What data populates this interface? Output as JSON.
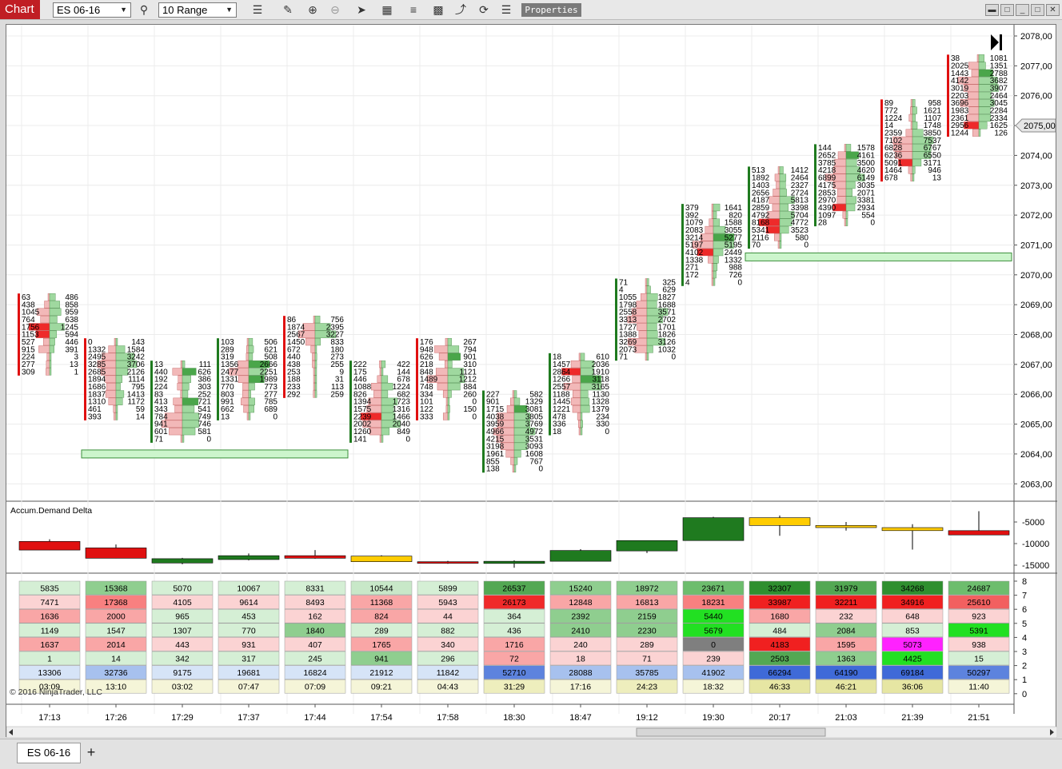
{
  "toolbar": {
    "title": "Chart",
    "instrument": "ES 06-16",
    "period": "10 Range",
    "properties_label": "Properties",
    "icons": [
      "search-icon",
      "bar-type-icon",
      "pencil-icon",
      "zoom-in-icon",
      "zoom-out-icon",
      "pointer-icon",
      "data-box-icon",
      "strategy-icon",
      "indicator-icon",
      "drawing-tools-icon",
      "reload-icon",
      "list-icon"
    ]
  },
  "window_buttons": [
    "minimize",
    "restore",
    "maximize",
    "close"
  ],
  "indicator_label": "Accum.Demand Delta",
  "copyright": "© 2016 NinjaTrader, LLC",
  "price_axis": [
    "2078,00",
    "2077,00",
    "2076,00",
    "2075,00",
    "2074,00",
    "2073,00",
    "2072,00",
    "2071,00",
    "2070,00",
    "2069,00",
    "2068,00",
    "2067,00",
    "2066,00",
    "2065,00",
    "2064,00",
    "2063,00"
  ],
  "current_price": "2075,00",
  "delta_axis": [
    "-5000",
    "-10000",
    "-15000"
  ],
  "table_axis": [
    "8",
    "7",
    "6",
    "5",
    "4",
    "3",
    "2",
    "1",
    "0"
  ],
  "time_labels": [
    "17:13",
    "17:26",
    "17:29",
    "17:37",
    "17:44",
    "17:54",
    "17:58",
    "18:30",
    "18:47",
    "19:12",
    "19:30",
    "20:17",
    "21:03",
    "21:39",
    "21:51"
  ],
  "colors": {
    "up": "#1f7a1f",
    "down": "#e01010",
    "neutral": "#ffcc00",
    "bid_bar": "#f2b8b8",
    "ask_bar": "#9fd89f"
  },
  "bars": [
    {
      "top": 2069.25,
      "side": "down",
      "rows": [
        [
          "63",
          "486"
        ],
        [
          "438",
          "858"
        ],
        [
          "1045",
          "959"
        ],
        [
          "764",
          "638"
        ],
        [
          "1756",
          "1245"
        ],
        [
          "1153",
          "594"
        ],
        [
          "527",
          "446"
        ],
        [
          "915",
          "391"
        ],
        [
          "224",
          "3"
        ],
        [
          "277",
          "13"
        ],
        [
          "309",
          "1"
        ]
      ]
    },
    {
      "top": 2067.75,
      "side": "down",
      "rows": [
        [
          "0",
          "143"
        ],
        [
          "1332",
          "1584"
        ],
        [
          "2495",
          "3242"
        ],
        [
          "3285",
          "3706"
        ],
        [
          "2685",
          "2126"
        ],
        [
          "1894",
          "1114"
        ],
        [
          "1686",
          "795"
        ],
        [
          "1837",
          "1413"
        ],
        [
          "1310",
          "1172"
        ],
        [
          "461",
          "59"
        ],
        [
          "393",
          "14"
        ]
      ]
    },
    {
      "top": 2067.0,
      "side": "up",
      "rows": [
        [
          "13",
          "111"
        ],
        [
          "440",
          "626"
        ],
        [
          "192",
          "386"
        ],
        [
          "224",
          "303"
        ],
        [
          "83",
          "252"
        ],
        [
          "413",
          "721"
        ],
        [
          "343",
          "541"
        ],
        [
          "784",
          "749"
        ],
        [
          "941",
          "746"
        ],
        [
          "601",
          "581"
        ],
        [
          "71",
          "0"
        ]
      ]
    },
    {
      "top": 2067.75,
      "side": "up",
      "rows": [
        [
          "103",
          "506"
        ],
        [
          "289",
          "621"
        ],
        [
          "319",
          "508"
        ],
        [
          "1356",
          "2666"
        ],
        [
          "2477",
          "2251"
        ],
        [
          "1331",
          "1989"
        ],
        [
          "770",
          "773"
        ],
        [
          "803",
          "277"
        ],
        [
          "991",
          "785"
        ],
        [
          "662",
          "689"
        ],
        [
          "13",
          "0"
        ]
      ]
    },
    {
      "top": 2068.5,
      "side": "down",
      "rows": [
        [
          "86",
          "756"
        ],
        [
          "1874",
          "2395"
        ],
        [
          "2567",
          "3227"
        ],
        [
          "1450",
          "833"
        ],
        [
          "672",
          "180"
        ],
        [
          "440",
          "273"
        ],
        [
          "438",
          "255"
        ],
        [
          "253",
          "9"
        ],
        [
          "188",
          "31"
        ],
        [
          "233",
          "113"
        ],
        [
          "292",
          "259"
        ]
      ]
    },
    {
      "top": 2067.0,
      "side": "up",
      "rows": [
        [
          "222",
          "422"
        ],
        [
          "175",
          "144"
        ],
        [
          "446",
          "678"
        ],
        [
          "1088",
          "1224"
        ],
        [
          "826",
          "682"
        ],
        [
          "1394",
          "1723"
        ],
        [
          "1575",
          "1316"
        ],
        [
          "2239",
          "1466"
        ],
        [
          "2002",
          "2040"
        ],
        [
          "1260",
          "849"
        ],
        [
          "141",
          "0"
        ]
      ]
    },
    {
      "top": 2067.75,
      "side": "down",
      "rows": [
        [
          "176",
          "267"
        ],
        [
          "948",
          "794"
        ],
        [
          "626",
          "901"
        ],
        [
          "218",
          "310"
        ],
        [
          "848",
          "1121"
        ],
        [
          "1489",
          "1212"
        ],
        [
          "748",
          "884"
        ],
        [
          "334",
          "260"
        ],
        [
          "101",
          "0"
        ],
        [
          "122",
          "150"
        ],
        [
          "333",
          "0"
        ]
      ]
    },
    {
      "top": 2066.0,
      "side": "up",
      "rows": [
        [
          "227",
          "582"
        ],
        [
          "901",
          "1329"
        ],
        [
          "1715",
          "3081"
        ],
        [
          "4038",
          "3805"
        ],
        [
          "3959",
          "3769"
        ],
        [
          "4966",
          "4972"
        ],
        [
          "4215",
          "3531"
        ],
        [
          "3198",
          "3093"
        ],
        [
          "1961",
          "1608"
        ],
        [
          "855",
          "767"
        ],
        [
          "138",
          "0"
        ]
      ]
    },
    {
      "top": 2067.25,
      "side": "up",
      "rows": [
        [
          "18",
          "610"
        ],
        [
          "1457",
          "2036"
        ],
        [
          "2864",
          "1910"
        ],
        [
          "1266",
          "3118"
        ],
        [
          "2557",
          "3165"
        ],
        [
          "1188",
          "1130"
        ],
        [
          "1445",
          "1328"
        ],
        [
          "1221",
          "1379"
        ],
        [
          "478",
          "234"
        ],
        [
          "336",
          "330"
        ],
        [
          "18",
          "0"
        ]
      ]
    },
    {
      "top": 2069.75,
      "side": "up",
      "rows": [
        [
          "71",
          "325"
        ],
        [
          "4",
          "629"
        ],
        [
          "1055",
          "1827"
        ],
        [
          "1798",
          "1688"
        ],
        [
          "2558",
          "3571"
        ],
        [
          "3313",
          "2702"
        ],
        [
          "1727",
          "1701"
        ],
        [
          "1388",
          "1826"
        ],
        [
          "3269",
          "3126"
        ],
        [
          "2073",
          "1032"
        ],
        [
          "71",
          "0"
        ]
      ]
    },
    {
      "top": 2072.25,
      "side": "up",
      "rows": [
        [
          "379",
          "1641"
        ],
        [
          "392",
          "820"
        ],
        [
          "1079",
          "1588"
        ],
        [
          "2083",
          "3055"
        ],
        [
          "3214",
          "5277"
        ],
        [
          "5197",
          "5195"
        ],
        [
          "4102",
          "2449"
        ],
        [
          "1338",
          "1332"
        ],
        [
          "271",
          "988"
        ],
        [
          "172",
          "726"
        ],
        [
          "4",
          "0"
        ]
      ]
    },
    {
      "top": 2073.5,
      "side": "up",
      "rows": [
        [
          "513",
          "1412"
        ],
        [
          "1892",
          "2464"
        ],
        [
          "1403",
          "2327"
        ],
        [
          "2656",
          "2724"
        ],
        [
          "4187",
          "5813"
        ],
        [
          "2859",
          "3398"
        ],
        [
          "4792",
          "5704"
        ],
        [
          "8168",
          "4772"
        ],
        [
          "5341",
          "3523"
        ],
        [
          "2116",
          "580"
        ],
        [
          "70",
          "0"
        ]
      ]
    },
    {
      "top": 2074.25,
      "side": "up",
      "rows": [
        [
          "144",
          "1578"
        ],
        [
          "2652",
          "4161"
        ],
        [
          "3785",
          "3500"
        ],
        [
          "4218",
          "4620"
        ],
        [
          "6899",
          "6149"
        ],
        [
          "4175",
          "3035"
        ],
        [
          "2853",
          "2071"
        ],
        [
          "2970",
          "3381"
        ],
        [
          "4390",
          "2934"
        ],
        [
          "1097",
          "554"
        ],
        [
          "28",
          "0"
        ]
      ]
    },
    {
      "top": 2075.75,
      "side": "down",
      "rows": [
        [
          "89",
          "958"
        ],
        [
          "772",
          "1621"
        ],
        [
          "1224",
          "1107"
        ],
        [
          "14",
          "1748"
        ],
        [
          "2359",
          "3850"
        ],
        [
          "7102",
          "7537"
        ],
        [
          "6828",
          "6767"
        ],
        [
          "6236",
          "6550"
        ],
        [
          "5091",
          "3171"
        ],
        [
          "1464",
          "946"
        ],
        [
          "678",
          "13"
        ]
      ]
    },
    {
      "top": 2077.25,
      "side": "down",
      "rows": [
        [
          "38",
          "1081"
        ],
        [
          "2025",
          "1351"
        ],
        [
          "1443",
          "2788"
        ],
        [
          "4142",
          "3682"
        ],
        [
          "3019",
          "3907"
        ],
        [
          "2203",
          "2464"
        ],
        [
          "3696",
          "3045"
        ],
        [
          "1983",
          "2284"
        ],
        [
          "2361",
          "2334"
        ],
        [
          "2956",
          "1625"
        ],
        [
          "1244",
          "126"
        ]
      ]
    }
  ],
  "zones": [
    {
      "from_bar": 1,
      "to_bar": 4,
      "price": 2064.0
    },
    {
      "from_bar": 11,
      "to_bar": 14,
      "price": 2070.6
    }
  ],
  "delta_bars": [
    {
      "open": -11500,
      "close": -9500,
      "high": -9000,
      "low": -11500,
      "color": "down"
    },
    {
      "open": -11000,
      "close": -13400,
      "high": -10200,
      "low": -13400,
      "color": "down"
    },
    {
      "open": -13500,
      "close": -14500,
      "high": -13300,
      "low": -14800,
      "color": "up"
    },
    {
      "open": -13700,
      "close": -12800,
      "high": -12300,
      "low": -13900,
      "color": "up"
    },
    {
      "open": -13400,
      "close": -12800,
      "high": -11500,
      "low": -13500,
      "color": "down"
    },
    {
      "open": -14200,
      "close": -12900,
      "high": -12700,
      "low": -14200,
      "color": "neutral"
    },
    {
      "open": -14200,
      "close": -14500,
      "high": -14000,
      "low": -14700,
      "color": "down"
    },
    {
      "open": -14600,
      "close": -14100,
      "high": -13900,
      "low": -15600,
      "color": "up"
    },
    {
      "open": -14100,
      "close": -11600,
      "high": -11300,
      "low": -14100,
      "color": "up"
    },
    {
      "open": -11700,
      "close": -9300,
      "high": -9300,
      "low": -12200,
      "color": "up"
    },
    {
      "open": -9300,
      "close": -4000,
      "high": -3800,
      "low": -9300,
      "color": "up"
    },
    {
      "open": -4000,
      "close": -5800,
      "high": -3500,
      "low": -8200,
      "color": "neutral"
    },
    {
      "open": -5800,
      "close": -6300,
      "high": -5000,
      "low": -7000,
      "color": "neutral"
    },
    {
      "open": -6300,
      "close": -7000,
      "high": -5500,
      "low": -11400,
      "color": "neutral"
    },
    {
      "open": -7000,
      "close": -8000,
      "high": -2500,
      "low": -7300,
      "color": "down"
    }
  ],
  "table_rows": [
    [
      "5835",
      "15368",
      "5070",
      "10067",
      "8331",
      "10544",
      "5899",
      "26537",
      "15240",
      "18972",
      "23671",
      "32307",
      "31979",
      "34268",
      "24687"
    ],
    [
      "7471",
      "17368",
      "4105",
      "9614",
      "8493",
      "11368",
      "5943",
      "26173",
      "12848",
      "16813",
      "18231",
      "33987",
      "32211",
      "34916",
      "25610"
    ],
    [
      "1636",
      "2000",
      "965",
      "453",
      "162",
      "824",
      "44",
      "364",
      "2392",
      "2159",
      "5440",
      "1680",
      "232",
      "648",
      "923"
    ],
    [
      "1149",
      "1547",
      "1307",
      "770",
      "1840",
      "289",
      "882",
      "436",
      "2410",
      "2230",
      "5679",
      "484",
      "2084",
      "853",
      "5391"
    ],
    [
      "1637",
      "2014",
      "443",
      "931",
      "407",
      "1765",
      "340",
      "1716",
      "240",
      "289",
      "0",
      "4183",
      "1595",
      "5073",
      "938"
    ],
    [
      "1",
      "14",
      "342",
      "317",
      "245",
      "941",
      "296",
      "72",
      "18",
      "71",
      "239",
      "2503",
      "1363",
      "4425",
      "15"
    ],
    [
      "13306",
      "32736",
      "9175",
      "19681",
      "16824",
      "21912",
      "11842",
      "52710",
      "28088",
      "35785",
      "41902",
      "66294",
      "64190",
      "69184",
      "50297"
    ],
    [
      "03:09",
      "13:10",
      "03:02",
      "07:47",
      "07:09",
      "09:21",
      "04:43",
      "31:29",
      "17:16",
      "24:23",
      "18:32",
      "46:33",
      "46:21",
      "36:06",
      "11:40"
    ]
  ],
  "table_colors": [
    [
      "#d5efd5",
      "#8fce8f",
      "#d5efd5",
      "#d5efd5",
      "#d5efd5",
      "#c8e8c8",
      "#d5efd5",
      "#53a853",
      "#8fce8f",
      "#8fce8f",
      "#6dbd6d",
      "#2f8f2f",
      "#53a853",
      "#2f8f2f",
      "#6dbd6d"
    ],
    [
      "#fbd3d3",
      "#f88080",
      "#fbd3d3",
      "#fbd3d3",
      "#fbd3d3",
      "#f9a6a6",
      "#fbd3d3",
      "#f02a2a",
      "#f9a6a6",
      "#f9a6a6",
      "#f88080",
      "#f02020",
      "#f02020",
      "#f02020",
      "#f26060"
    ],
    [
      "#f9a6a6",
      "#f9a6a6",
      "#d5efd5",
      "#d5efd5",
      "#fbd3d3",
      "#f9a6a6",
      "#fbd3d3",
      "#d5efd5",
      "#8fce8f",
      "#8fce8f",
      "#22e022",
      "#f9a6a6",
      "#fbd3d3",
      "#fbd3d3",
      "#fbd3d3"
    ],
    [
      "#d5efd5",
      "#d5efd5",
      "#d5efd5",
      "#d5efd5",
      "#8fce8f",
      "#d5efd5",
      "#d5efd5",
      "#d5efd5",
      "#8fce8f",
      "#8fce8f",
      "#22e022",
      "#d5efd5",
      "#8fce8f",
      "#d5efd5",
      "#22e022"
    ],
    [
      "#f9a6a6",
      "#f9a6a6",
      "#fbd3d3",
      "#fbd3d3",
      "#fbd3d3",
      "#f9a6a6",
      "#fbd3d3",
      "#f9a6a6",
      "#fbd3d3",
      "#fbd3d3",
      "#7f7f7f",
      "#f02020",
      "#f9a6a6",
      "#ff22ff",
      "#fbd3d3"
    ],
    [
      "#d5efd5",
      "#d5efd5",
      "#d5efd5",
      "#d5efd5",
      "#d5efd5",
      "#8fce8f",
      "#d5efd5",
      "#f9a6a6",
      "#fbd3d3",
      "#fbd3d3",
      "#fbd3d3",
      "#53a853",
      "#8fce8f",
      "#22e022",
      "#d5efd5"
    ],
    [
      "#d6e4f7",
      "#a7c1ee",
      "#d6e4f7",
      "#d6e4f7",
      "#d6e4f7",
      "#d6e4f7",
      "#d6e4f7",
      "#5d83de",
      "#a7c1ee",
      "#a7c1ee",
      "#a7c1ee",
      "#3f6ad8",
      "#3f6ad8",
      "#3f6ad8",
      "#5d83de"
    ],
    [
      "#f5f5d8",
      "#f5f5d8",
      "#f5f5d8",
      "#f5f5d8",
      "#f5f5d8",
      "#f5f5d8",
      "#f5f5d8",
      "#eeeebd",
      "#f5f5d8",
      "#eeeebd",
      "#f5f5d8",
      "#e6e6a3",
      "#e6e6a3",
      "#e6e6a3",
      "#f5f5d8"
    ]
  ],
  "bottom_tabs": {
    "active": "ES 06-16",
    "add": "+"
  }
}
